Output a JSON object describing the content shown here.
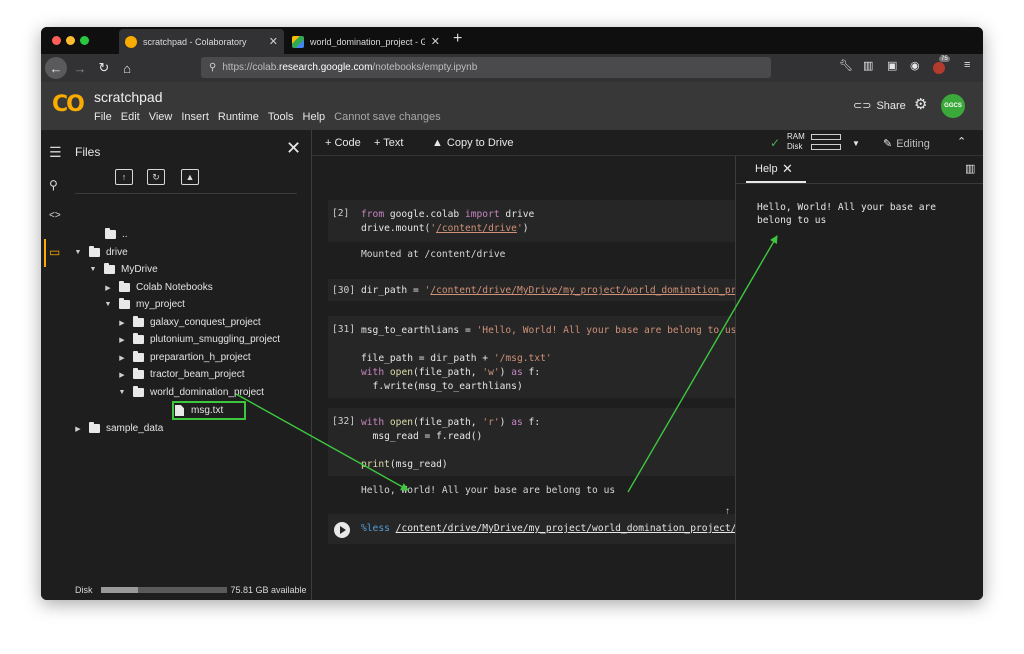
{
  "browser": {
    "tabs": [
      {
        "label": "scratchpad - Colaboratory",
        "close": "✕"
      },
      {
        "label": "world_domination_project - Go",
        "close": "✕"
      }
    ],
    "new_tab": "+",
    "url_prefix": "https://colab.",
    "url_host": "research.google.com",
    "url_path": "/notebooks/empty.ipynb",
    "extension_badge": "75"
  },
  "header": {
    "logo": "CO",
    "title": "scratchpad",
    "menu": [
      "File",
      "Edit",
      "View",
      "Insert",
      "Runtime",
      "Tools",
      "Help"
    ],
    "save_status": "Cannot save changes",
    "share_label": "Share",
    "avatar": "GGCS"
  },
  "files_panel": {
    "title": "Files",
    "tree": [
      {
        "label": "..",
        "depth": 1,
        "kind": "up"
      },
      {
        "label": "drive",
        "depth": 0,
        "kind": "folder",
        "state": "open"
      },
      {
        "label": "MyDrive",
        "depth": 1,
        "kind": "folder",
        "state": "open"
      },
      {
        "label": "Colab Notebooks",
        "depth": 2,
        "kind": "folder",
        "state": "closed"
      },
      {
        "label": "my_project",
        "depth": 2,
        "kind": "folder",
        "state": "open"
      },
      {
        "label": "galaxy_conquest_project",
        "depth": 3,
        "kind": "folder",
        "state": "closed"
      },
      {
        "label": "plutonium_smuggling_project",
        "depth": 3,
        "kind": "folder",
        "state": "closed"
      },
      {
        "label": "preparartion_h_project",
        "depth": 3,
        "kind": "folder",
        "state": "closed"
      },
      {
        "label": "tractor_beam_project",
        "depth": 3,
        "kind": "folder",
        "state": "closed"
      },
      {
        "label": "world_domination_project",
        "depth": 3,
        "kind": "folder",
        "state": "open"
      },
      {
        "label": "msg.txt",
        "depth": 4,
        "kind": "file"
      },
      {
        "label": "sample_data",
        "depth": 0,
        "kind": "folder",
        "state": "closed"
      }
    ],
    "disk_label": "Disk",
    "disk_used_fraction": 0.3,
    "disk_available": "75.81 GB available"
  },
  "toolbar": {
    "add_code": "+ Code",
    "add_text": "+ Text",
    "copy_to_drive": "Copy to Drive",
    "ram_label": "RAM",
    "disk_label": "Disk",
    "editing": "Editing"
  },
  "cells": [
    {
      "num": "[2]",
      "output": "Mounted at /content/drive"
    },
    {
      "num": "[30]"
    },
    {
      "num": "[31]"
    },
    {
      "num": "[32]",
      "output": "Hello, World! All your base are belong to us"
    }
  ],
  "help": {
    "tab": "Help",
    "text": "Hello, World! All your base are belong to us"
  },
  "colors": {
    "accent": "#f9ab00",
    "highlight": "#3ec73e",
    "avatar": "#3aa83a"
  }
}
